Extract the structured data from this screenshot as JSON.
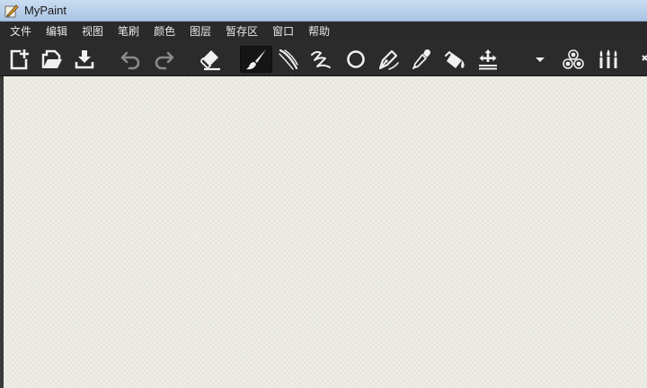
{
  "window": {
    "title": "MyPaint",
    "icon": "mypaint-app-icon"
  },
  "menubar": {
    "items": [
      {
        "label": "文件"
      },
      {
        "label": "编辑"
      },
      {
        "label": "视图"
      },
      {
        "label": "笔刷"
      },
      {
        "label": "颜色"
      },
      {
        "label": "图层"
      },
      {
        "label": "暂存区"
      },
      {
        "label": "窗口"
      },
      {
        "label": "帮助"
      }
    ]
  },
  "toolbar": {
    "active_tool": "freehand-brush",
    "icon_color": "#f0f0f0",
    "disabled_icon_color": "#8a8a8a",
    "buttons": [
      {
        "icon": "new-document-icon"
      },
      {
        "icon": "open-document-icon"
      },
      {
        "icon": "save-document-icon"
      },
      {
        "icon": "undo-icon"
      },
      {
        "icon": "redo-icon"
      },
      {
        "icon": "eraser-icon"
      },
      {
        "icon": "freehand-brush-icon"
      },
      {
        "icon": "inking-tool-icon"
      },
      {
        "icon": "connected-lines-icon"
      },
      {
        "icon": "ellipse-tool-icon"
      },
      {
        "icon": "pen-nib-icon"
      },
      {
        "icon": "color-picker-icon"
      },
      {
        "icon": "fill-bucket-icon"
      },
      {
        "icon": "pan-view-icon"
      },
      {
        "icon": "dropdown-arrow-icon"
      },
      {
        "icon": "color-circles-icon"
      },
      {
        "icon": "brush-group-icon"
      }
    ]
  },
  "canvas": {
    "background_color": "#efefe6"
  }
}
